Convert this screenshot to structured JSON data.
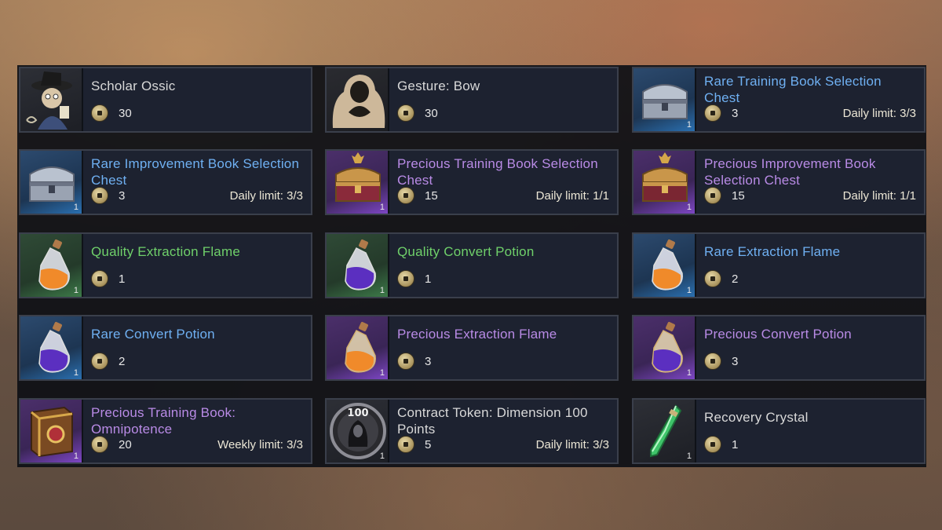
{
  "shop": {
    "items": [
      {
        "name": "Scholar Ossic",
        "price": "30",
        "qty": "",
        "limit": "",
        "rarity": "white",
        "icon": "scholar-ossic-portrait-icon"
      },
      {
        "name": "Gesture: Bow",
        "price": "30",
        "qty": "",
        "limit": "",
        "rarity": "white",
        "icon": "gesture-bow-icon"
      },
      {
        "name": "Rare Training Book Selection Chest",
        "price": "3",
        "qty": "1",
        "limit": "Daily limit: 3/3",
        "rarity": "blue",
        "icon": "silver-chest-icon"
      },
      {
        "name": "Rare Improvement Book Selection Chest",
        "price": "3",
        "qty": "1",
        "limit": "Daily limit: 3/3",
        "rarity": "blue",
        "icon": "silver-chest-icon"
      },
      {
        "name": "Precious Training Book Selection Chest",
        "price": "15",
        "qty": "1",
        "limit": "Daily limit: 1/1",
        "rarity": "purple",
        "icon": "ornate-chest-icon"
      },
      {
        "name": "Precious Improvement Book Selection Chest",
        "price": "15",
        "qty": "1",
        "limit": "Daily limit: 1/1",
        "rarity": "purple",
        "icon": "ornate-chest-icon"
      },
      {
        "name": "Quality Extraction Flame",
        "price": "1",
        "qty": "1",
        "limit": "",
        "rarity": "green",
        "icon": "orange-potion-icon"
      },
      {
        "name": "Quality Convert Potion",
        "price": "1",
        "qty": "1",
        "limit": "",
        "rarity": "green",
        "icon": "purple-potion-icon"
      },
      {
        "name": "Rare Extraction Flame",
        "price": "2",
        "qty": "1",
        "limit": "",
        "rarity": "blue",
        "icon": "orange-potion-icon"
      },
      {
        "name": "Rare Convert Potion",
        "price": "2",
        "qty": "1",
        "limit": "",
        "rarity": "blue",
        "icon": "purple-potion-icon"
      },
      {
        "name": "Precious Extraction Flame",
        "price": "3",
        "qty": "1",
        "limit": "",
        "rarity": "purple",
        "icon": "orange-potion-icon"
      },
      {
        "name": "Precious Convert Potion",
        "price": "3",
        "qty": "1",
        "limit": "",
        "rarity": "purple",
        "icon": "purple-potion-icon"
      },
      {
        "name": "Precious Training Book: Omnipotence",
        "price": "20",
        "qty": "1",
        "limit": "Weekly limit: 3/3",
        "rarity": "purple",
        "icon": "spell-book-icon"
      },
      {
        "name": "Contract Token: Dimension 100 Points",
        "price": "5",
        "qty": "1",
        "limit": "Daily limit: 3/3",
        "rarity": "white",
        "icon": "contract-token-100-icon"
      },
      {
        "name": "Recovery Crystal",
        "price": "1",
        "qty": "1",
        "limit": "",
        "rarity": "white",
        "icon": "green-crystal-icon"
      }
    ],
    "token_badge": "100"
  },
  "colors": {
    "white": "#d8d8d8",
    "blue": "#6fb0f2",
    "purple": "#b98be6",
    "green": "#6fd06a"
  }
}
